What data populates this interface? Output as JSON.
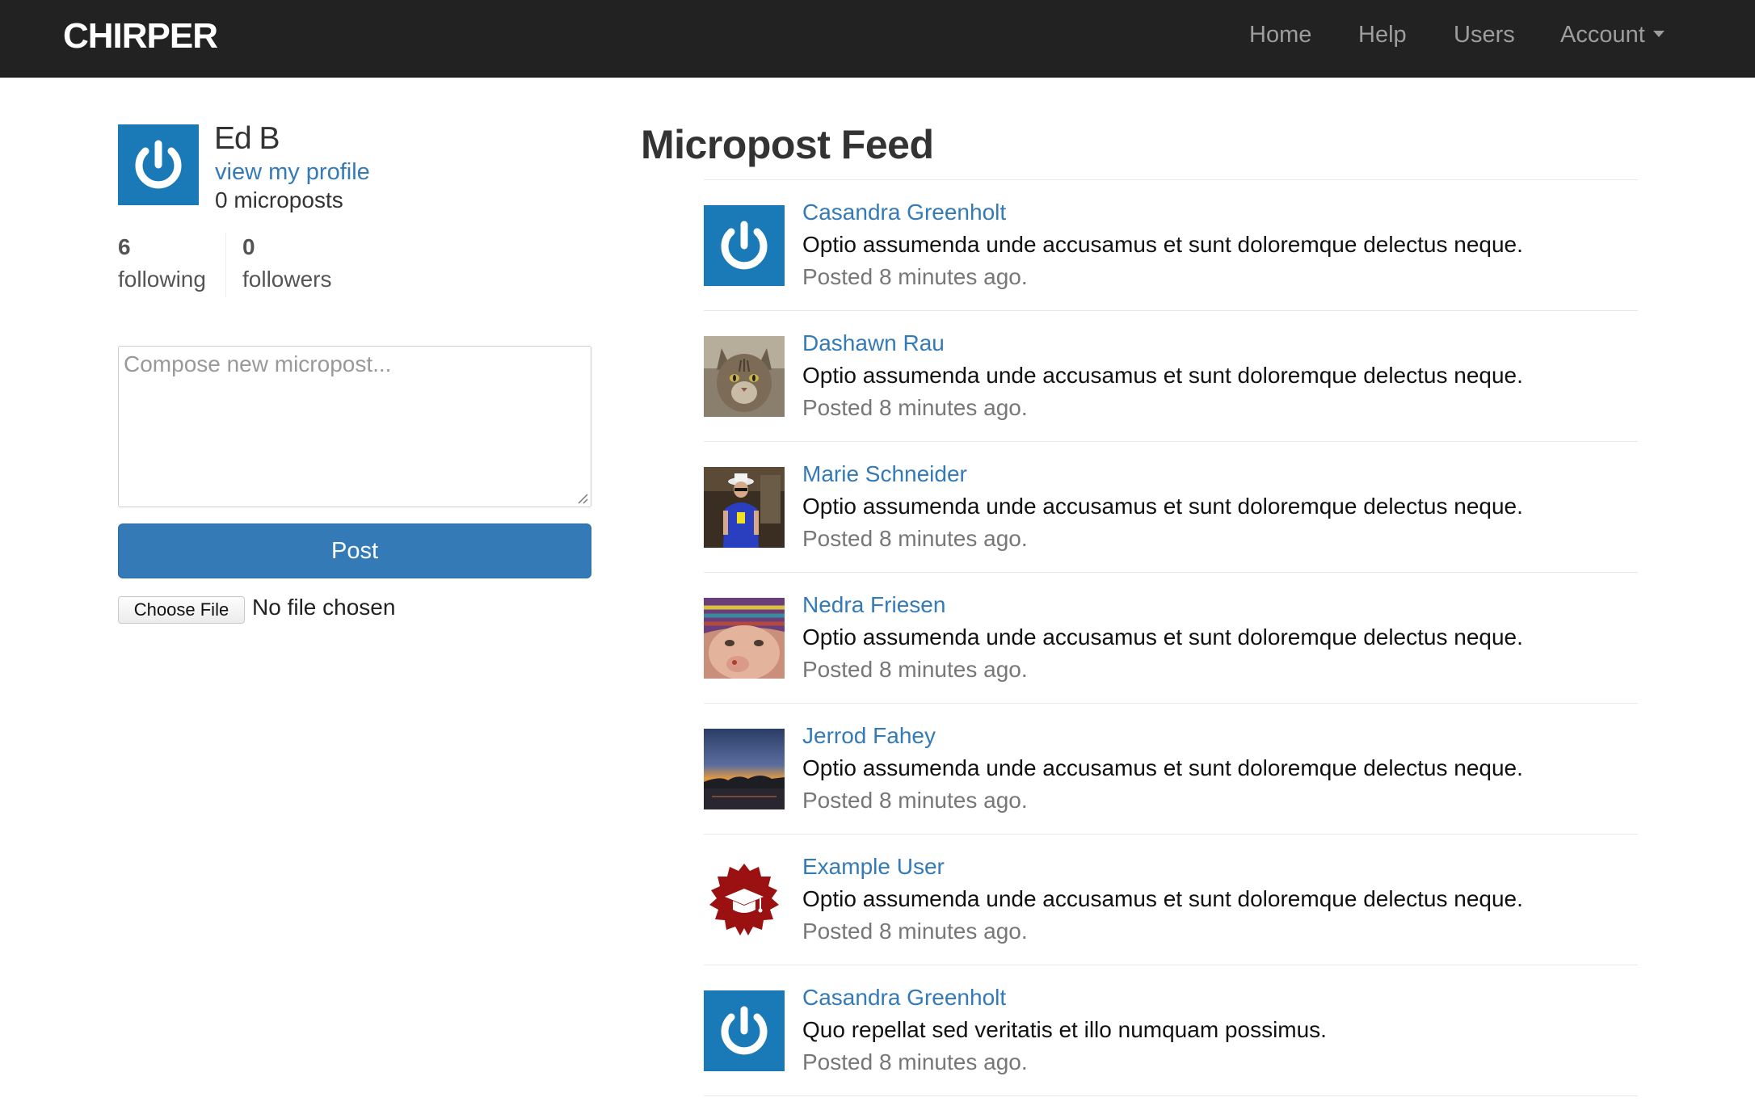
{
  "navbar": {
    "brand": "CHIRPER",
    "links": {
      "home": "Home",
      "help": "Help",
      "users": "Users",
      "account": "Account"
    }
  },
  "sidebar": {
    "user_name": "Ed B",
    "profile_link": "view my profile",
    "micropost_count": "0 microposts",
    "stats": {
      "following_count": "6",
      "following_label": "following",
      "followers_count": "0",
      "followers_label": "followers"
    },
    "compose": {
      "placeholder": "Compose new micropost...",
      "value": ""
    },
    "post_button": "Post",
    "file_button": "Choose File",
    "file_status": "No file chosen"
  },
  "feed": {
    "title": "Micropost Feed",
    "items": [
      {
        "user": "Casandra Greenholt",
        "content": "Optio assumenda unde accusamus et sunt doloremque delectus neque.",
        "time": "Posted 8 minutes ago.",
        "avatar": "gravatar-default-icon"
      },
      {
        "user": "Dashawn Rau",
        "content": "Optio assumenda unde accusamus et sunt doloremque delectus neque.",
        "time": "Posted 8 minutes ago.",
        "avatar": "cat-photo"
      },
      {
        "user": "Marie Schneider",
        "content": "Optio assumenda unde accusamus et sunt doloremque delectus neque.",
        "time": "Posted 8 minutes ago.",
        "avatar": "person-photo"
      },
      {
        "user": "Nedra Friesen",
        "content": "Optio assumenda unde accusamus et sunt doloremque delectus neque.",
        "time": "Posted 8 minutes ago.",
        "avatar": "baby-photo"
      },
      {
        "user": "Jerrod Fahey",
        "content": "Optio assumenda unde accusamus et sunt doloremque delectus neque.",
        "time": "Posted 8 minutes ago.",
        "avatar": "sunset-photo"
      },
      {
        "user": "Example User",
        "content": "Optio assumenda unde accusamus et sunt doloremque delectus neque.",
        "time": "Posted 8 minutes ago.",
        "avatar": "graduation-badge-icon"
      },
      {
        "user": "Casandra Greenholt",
        "content": "Quo repellat sed veritatis et illo numquam possimus.",
        "time": "Posted 8 minutes ago.",
        "avatar": "gravatar-default-icon"
      }
    ]
  },
  "colors": {
    "navbar_bg": "#222222",
    "link": "#337ab7",
    "button": "#337ab7",
    "gravatar_bg": "#1a7ab8",
    "badge_red": "#9b1010"
  }
}
